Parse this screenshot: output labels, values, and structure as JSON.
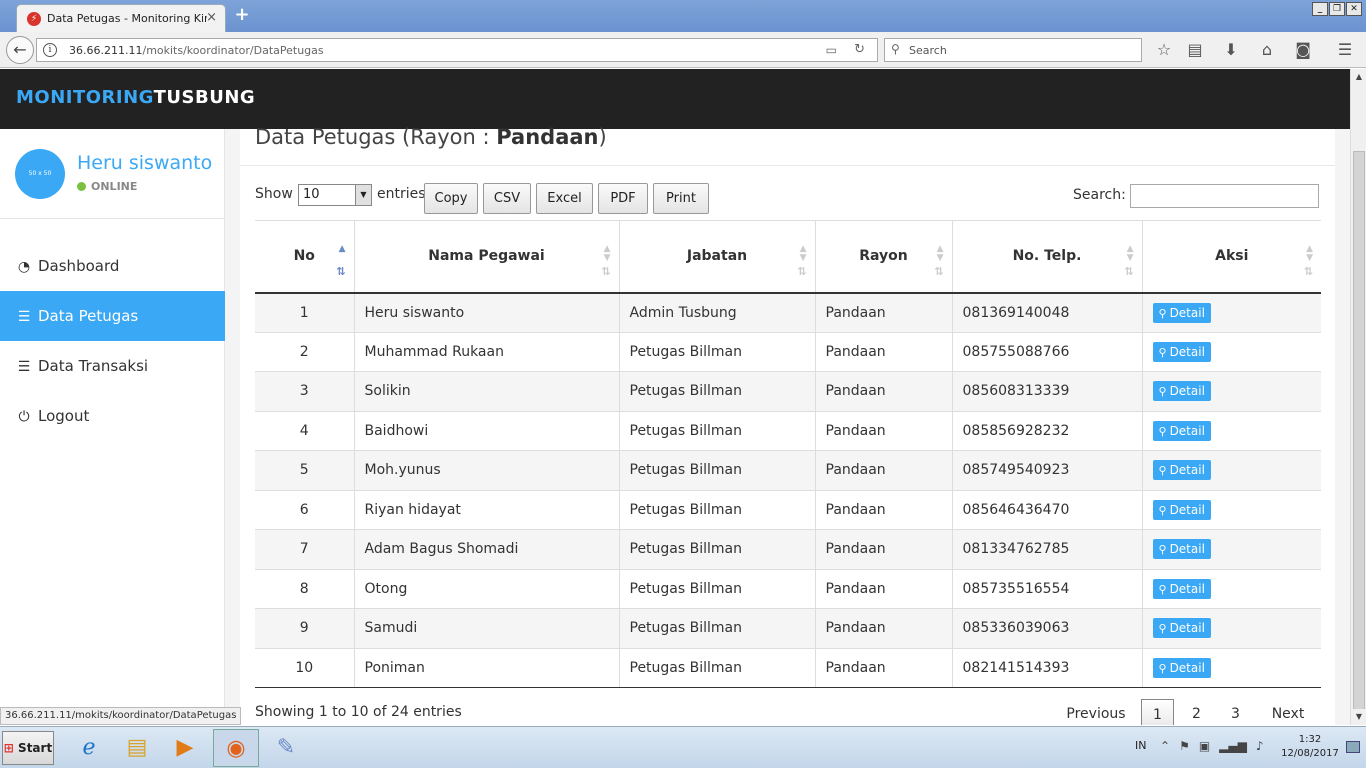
{
  "browser": {
    "tab_title": "Data Petugas - Monitoring Kiner",
    "tab_close": "×",
    "new_tab": "+",
    "url_host": "36.66.211.11",
    "url_path": "/mokits/koordinator/DataPetugas",
    "search_placeholder": "Search",
    "status_url": "36.66.211.11/mokits/koordinator/DataPetugas"
  },
  "brand": {
    "part1": "MONITORING",
    "part2": "TUSBUNG"
  },
  "user": {
    "avatar_text": "50 x 50",
    "name": "Heru siswanto",
    "status": "ONLINE"
  },
  "menu": [
    {
      "label": "Dashboard",
      "icon": "dashboard-icon",
      "active": false
    },
    {
      "label": "Data Petugas",
      "icon": "list-icon",
      "active": true
    },
    {
      "label": "Data Transaksi",
      "icon": "list-icon",
      "active": false
    },
    {
      "label": "Logout",
      "icon": "power-icon",
      "active": false
    }
  ],
  "heading": {
    "prefix": "Data Petugas (Rayon : ",
    "rayon": "Pandaan",
    "suffix": ")"
  },
  "controls": {
    "show_label": "Show",
    "length_value": "10",
    "entries_label": "entries",
    "buttons": [
      "Copy",
      "CSV",
      "Excel",
      "PDF",
      "Print"
    ],
    "search_label": "Search:"
  },
  "table": {
    "headers": [
      "No",
      "Nama Pegawai",
      "Jabatan",
      "Rayon",
      "No. Telp.",
      "Aksi"
    ],
    "rows": [
      {
        "no": "1",
        "nama": "Heru siswanto",
        "jabatan": "Admin Tusbung",
        "rayon": "Pandaan",
        "telp": "081369140048",
        "aksi": "Detail"
      },
      {
        "no": "2",
        "nama": "Muhammad Rukaan",
        "jabatan": "Petugas Billman",
        "rayon": "Pandaan",
        "telp": "085755088766",
        "aksi": "Detail"
      },
      {
        "no": "3",
        "nama": "Solikin",
        "jabatan": "Petugas Billman",
        "rayon": "Pandaan",
        "telp": "085608313339",
        "aksi": "Detail"
      },
      {
        "no": "4",
        "nama": "Baidhowi",
        "jabatan": "Petugas Billman",
        "rayon": "Pandaan",
        "telp": "085856928232",
        "aksi": "Detail"
      },
      {
        "no": "5",
        "nama": "Moh.yunus",
        "jabatan": "Petugas Billman",
        "rayon": "Pandaan",
        "telp": "085749540923",
        "aksi": "Detail"
      },
      {
        "no": "6",
        "nama": "Riyan hidayat",
        "jabatan": "Petugas Billman",
        "rayon": "Pandaan",
        "telp": "085646436470",
        "aksi": "Detail"
      },
      {
        "no": "7",
        "nama": "Adam Bagus Shomadi",
        "jabatan": "Petugas Billman",
        "rayon": "Pandaan",
        "telp": "081334762785",
        "aksi": "Detail"
      },
      {
        "no": "8",
        "nama": "Otong",
        "jabatan": "Petugas Billman",
        "rayon": "Pandaan",
        "telp": "085735516554",
        "aksi": "Detail"
      },
      {
        "no": "9",
        "nama": "Samudi",
        "jabatan": "Petugas Billman",
        "rayon": "Pandaan",
        "telp": "085336039063",
        "aksi": "Detail"
      },
      {
        "no": "10",
        "nama": "Poniman",
        "jabatan": "Petugas Billman",
        "rayon": "Pandaan",
        "telp": "082141514393",
        "aksi": "Detail"
      }
    ]
  },
  "footer": {
    "info": "Showing 1 to 10 of 24 entries",
    "previous": "Previous",
    "pages": [
      "1",
      "2",
      "3"
    ],
    "current_page": "1",
    "next": "Next"
  },
  "taskbar": {
    "start": "Start",
    "lang": "IN",
    "time": "1:32",
    "date": "12/08/2017"
  },
  "colors": {
    "accent": "#3aa8f4",
    "topbar": "#222222",
    "online": "#7ac142"
  }
}
